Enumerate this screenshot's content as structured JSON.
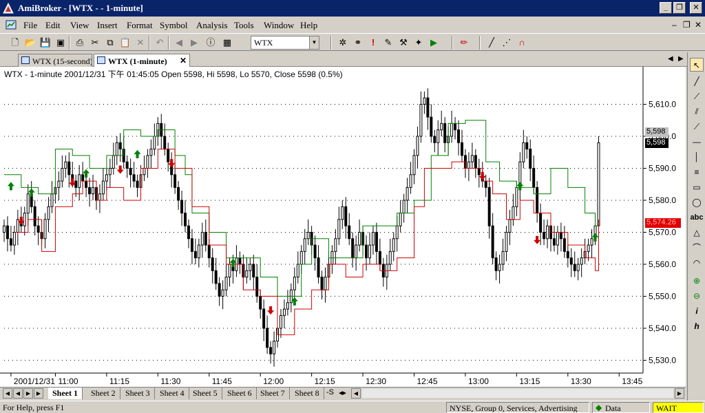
{
  "window": {
    "title": "AmiBroker - [WTX -   - 1-minute]"
  },
  "menu": {
    "items": [
      "File",
      "Edit",
      "View",
      "Insert",
      "Format",
      "Symbol",
      "Analysis",
      "Tools",
      "Window",
      "Help"
    ]
  },
  "toolbar": {
    "symbol_value": "WTX"
  },
  "tabs": [
    {
      "label": "WTX (15-second)"
    },
    {
      "label": "WTX (1-minute)"
    }
  ],
  "chart_header": "WTX - 1-minute 2001/12/31 下午 01:45:05 Open 5598, Hi 5598, Lo 5570, Close 5598 (0.5%)",
  "price_labels": {
    "gray": "5,598",
    "black": "5,598",
    "red": "5,574.26"
  },
  "sheets": [
    "Sheet 1",
    "Sheet 2",
    "Sheet 3",
    "Sheet 4",
    "Sheet 5",
    "Sheet 6",
    "Sheet 7",
    "Sheet 8"
  ],
  "sheet_extra": "-S",
  "status": {
    "help": "For Help, press F1",
    "info": "NYSE, Group 0, Services, Advertising",
    "data": "Data",
    "wait": "WAIT"
  },
  "colors": {
    "title_bg": "#0a246a",
    "candle": "#000000",
    "up_line": "#008000",
    "down_line": "#cc0000",
    "arrow_up": "#008000",
    "arrow_down": "#cc0000",
    "wait_bg": "#ffff00"
  },
  "chart_data": {
    "type": "candlestick",
    "title": "WTX - 1-minute 2001/12/31 下午 01:45:05 Open 5598, Hi 5598, Lo 5570, Close 5598 (0.5%)",
    "ylim": [
      5526,
      5620
    ],
    "y_ticks": [
      "5,530.0",
      "5,540.0",
      "5,550.0",
      "5,560.0",
      "5,570.0",
      "5,580.0",
      "5,590.0",
      "5,600.0",
      "5,610.0"
    ],
    "y_tick_values": [
      5530,
      5540,
      5550,
      5560,
      5570,
      5580,
      5590,
      5600,
      5610
    ],
    "x_ticks": [
      "2001/12/31",
      "11:00",
      "11:15",
      "11:30",
      "11:45",
      "12:00",
      "12:15",
      "12:30",
      "12:45",
      "13:00",
      "13:15",
      "13:30",
      "13:45"
    ],
    "x_tick_minutes": [
      -13,
      0,
      15,
      30,
      45,
      60,
      75,
      90,
      105,
      120,
      135,
      150,
      165
    ],
    "minute_start": -15,
    "minute_end": 172,
    "close_series": [
      [
        -15,
        5572
      ],
      [
        -14,
        5568
      ],
      [
        -13,
        5566
      ],
      [
        -12,
        5570
      ],
      [
        -11,
        5574
      ],
      [
        -10,
        5572
      ],
      [
        -9,
        5576
      ],
      [
        -8,
        5582
      ],
      [
        -7,
        5578
      ],
      [
        -6,
        5572
      ],
      [
        -5,
        5570
      ],
      [
        -4,
        5568
      ],
      [
        -3,
        5574
      ],
      [
        -2,
        5578
      ],
      [
        -1,
        5582
      ],
      [
        0,
        5584
      ],
      [
        1,
        5586
      ],
      [
        2,
        5590
      ],
      [
        3,
        5592
      ],
      [
        4,
        5588
      ],
      [
        5,
        5586
      ],
      [
        6,
        5584
      ],
      [
        7,
        5588
      ],
      [
        8,
        5586
      ],
      [
        9,
        5584
      ],
      [
        10,
        5582
      ],
      [
        11,
        5584
      ],
      [
        12,
        5580
      ],
      [
        13,
        5582
      ],
      [
        14,
        5586
      ],
      [
        15,
        5588
      ],
      [
        16,
        5590
      ],
      [
        17,
        5594
      ],
      [
        18,
        5598
      ],
      [
        19,
        5596
      ],
      [
        20,
        5592
      ],
      [
        21,
        5590
      ],
      [
        22,
        5588
      ],
      [
        23,
        5586
      ],
      [
        24,
        5584
      ],
      [
        25,
        5588
      ],
      [
        26,
        5590
      ],
      [
        27,
        5594
      ],
      [
        28,
        5596
      ],
      [
        29,
        5600
      ],
      [
        30,
        5604
      ],
      [
        31,
        5600
      ],
      [
        32,
        5596
      ],
      [
        33,
        5592
      ],
      [
        34,
        5588
      ],
      [
        35,
        5584
      ],
      [
        36,
        5580
      ],
      [
        37,
        5576
      ],
      [
        38,
        5572
      ],
      [
        39,
        5568
      ],
      [
        40,
        5564
      ],
      [
        41,
        5562
      ],
      [
        42,
        5566
      ],
      [
        43,
        5570
      ],
      [
        44,
        5566
      ],
      [
        45,
        5562
      ],
      [
        46,
        5558
      ],
      [
        47,
        5554
      ],
      [
        48,
        5550
      ],
      [
        49,
        5552
      ],
      [
        50,
        5556
      ],
      [
        51,
        5560
      ],
      [
        52,
        5558
      ],
      [
        53,
        5562
      ],
      [
        54,
        5560
      ],
      [
        55,
        5556
      ],
      [
        56,
        5558
      ],
      [
        57,
        5560
      ],
      [
        58,
        5556
      ],
      [
        59,
        5550
      ],
      [
        60,
        5546
      ],
      [
        61,
        5540
      ],
      [
        62,
        5534
      ],
      [
        63,
        5532
      ],
      [
        64,
        5536
      ],
      [
        65,
        5540
      ],
      [
        66,
        5544
      ],
      [
        67,
        5546
      ],
      [
        68,
        5548
      ],
      [
        69,
        5552
      ],
      [
        70,
        5556
      ],
      [
        71,
        5560
      ],
      [
        72,
        5564
      ],
      [
        73,
        5568
      ],
      [
        74,
        5570
      ],
      [
        75,
        5566
      ],
      [
        76,
        5562
      ],
      [
        77,
        5556
      ],
      [
        78,
        5552
      ],
      [
        79,
        5556
      ],
      [
        80,
        5560
      ],
      [
        81,
        5564
      ],
      [
        82,
        5568
      ],
      [
        83,
        5574
      ],
      [
        84,
        5578
      ],
      [
        85,
        5572
      ],
      [
        86,
        5568
      ],
      [
        87,
        5562
      ],
      [
        88,
        5566
      ],
      [
        89,
        5570
      ],
      [
        90,
        5566
      ],
      [
        91,
        5562
      ],
      [
        92,
        5566
      ],
      [
        93,
        5570
      ],
      [
        94,
        5564
      ],
      [
        95,
        5560
      ],
      [
        96,
        5556
      ],
      [
        97,
        5560
      ],
      [
        98,
        5564
      ],
      [
        99,
        5568
      ],
      [
        100,
        5572
      ],
      [
        101,
        5576
      ],
      [
        102,
        5580
      ],
      [
        103,
        5584
      ],
      [
        104,
        5588
      ],
      [
        105,
        5594
      ],
      [
        106,
        5600
      ],
      [
        107,
        5610
      ],
      [
        108,
        5612
      ],
      [
        109,
        5606
      ],
      [
        110,
        5600
      ],
      [
        111,
        5598
      ],
      [
        112,
        5602
      ],
      [
        113,
        5604
      ],
      [
        114,
        5598
      ],
      [
        115,
        5600
      ],
      [
        116,
        5604
      ],
      [
        117,
        5602
      ],
      [
        118,
        5598
      ],
      [
        119,
        5594
      ],
      [
        120,
        5590
      ],
      [
        121,
        5592
      ],
      [
        122,
        5594
      ],
      [
        123,
        5590
      ],
      [
        124,
        5588
      ],
      [
        125,
        5586
      ],
      [
        126,
        5584
      ],
      [
        127,
        5572
      ],
      [
        128,
        5562
      ],
      [
        129,
        5558
      ],
      [
        130,
        5560
      ],
      [
        131,
        5564
      ],
      [
        132,
        5570
      ],
      [
        133,
        5574
      ],
      [
        134,
        5578
      ],
      [
        135,
        5584
      ],
      [
        136,
        5592
      ],
      [
        137,
        5598
      ],
      [
        138,
        5596
      ],
      [
        139,
        5590
      ],
      [
        140,
        5584
      ],
      [
        141,
        5576
      ],
      [
        142,
        5570
      ],
      [
        143,
        5568
      ],
      [
        144,
        5572
      ],
      [
        145,
        5568
      ],
      [
        146,
        5566
      ],
      [
        147,
        5570
      ],
      [
        148,
        5568
      ],
      [
        149,
        5564
      ],
      [
        150,
        5562
      ],
      [
        151,
        5560
      ],
      [
        152,
        5558
      ],
      [
        153,
        5560
      ],
      [
        154,
        5562
      ],
      [
        155,
        5564
      ],
      [
        156,
        5566
      ],
      [
        157,
        5568
      ],
      [
        158,
        5572
      ],
      [
        159,
        5598
      ]
    ],
    "upper_line": [
      [
        -15,
        5588
      ],
      [
        -10,
        5584
      ],
      [
        -5,
        5582
      ],
      [
        0,
        5596
      ],
      [
        5,
        5594
      ],
      [
        10,
        5590
      ],
      [
        15,
        5594
      ],
      [
        20,
        5602
      ],
      [
        25,
        5600
      ],
      [
        30,
        5602
      ],
      [
        33,
        5602
      ],
      [
        35,
        5594
      ],
      [
        38,
        5588
      ],
      [
        40,
        5576
      ],
      [
        45,
        5570
      ],
      [
        50,
        5562
      ],
      [
        55,
        5562
      ],
      [
        58,
        5562
      ],
      [
        60,
        5556
      ],
      [
        65,
        5550
      ],
      [
        68,
        5550
      ],
      [
        72,
        5560
      ],
      [
        75,
        5568
      ],
      [
        80,
        5562
      ],
      [
        90,
        5572
      ],
      [
        100,
        5576
      ],
      [
        105,
        5580
      ],
      [
        110,
        5594
      ],
      [
        115,
        5604
      ],
      [
        120,
        5605
      ],
      [
        124,
        5605
      ],
      [
        126,
        5592
      ],
      [
        130,
        5586
      ],
      [
        135,
        5584
      ],
      [
        140,
        5582
      ],
      [
        145,
        5590
      ],
      [
        150,
        5584
      ],
      [
        155,
        5576
      ],
      [
        158,
        5572
      ],
      [
        159,
        5570
      ]
    ],
    "lower_line": [
      [
        -12,
        5570
      ],
      [
        -8,
        5574
      ],
      [
        -4,
        5564
      ],
      [
        0,
        5578
      ],
      [
        5,
        5582
      ],
      [
        8,
        5586
      ],
      [
        12,
        5580
      ],
      [
        15,
        5584
      ],
      [
        20,
        5580
      ],
      [
        25,
        5590
      ],
      [
        30,
        5596
      ],
      [
        35,
        5590
      ],
      [
        40,
        5578
      ],
      [
        45,
        5566
      ],
      [
        50,
        5560
      ],
      [
        55,
        5552
      ],
      [
        60,
        5550
      ],
      [
        65,
        5538
      ],
      [
        70,
        5546
      ],
      [
        75,
        5552
      ],
      [
        80,
        5560
      ],
      [
        85,
        5556
      ],
      [
        90,
        5560
      ],
      [
        95,
        5558
      ],
      [
        100,
        5562
      ],
      [
        105,
        5578
      ],
      [
        108,
        5590
      ],
      [
        112,
        5590
      ],
      [
        116,
        5592
      ],
      [
        120,
        5590
      ],
      [
        125,
        5586
      ],
      [
        128,
        5582
      ],
      [
        132,
        5574
      ],
      [
        136,
        5580
      ],
      [
        140,
        5576
      ],
      [
        145,
        5570
      ],
      [
        150,
        5566
      ],
      [
        155,
        5562
      ],
      [
        158,
        5558
      ],
      [
        159,
        5574
      ]
    ],
    "buy_signals": [
      [
        -13,
        5584
      ],
      [
        -7,
        5582
      ],
      [
        9,
        5588
      ],
      [
        24,
        5594
      ],
      [
        52,
        5560
      ],
      [
        70,
        5548
      ],
      [
        136,
        5584
      ],
      [
        158,
        5568
      ]
    ],
    "sell_signals": [
      [
        -10,
        5574
      ],
      [
        5,
        5586
      ],
      [
        19,
        5590
      ],
      [
        34,
        5592
      ],
      [
        63,
        5546
      ],
      [
        125,
        5588
      ],
      [
        141,
        5568
      ]
    ]
  }
}
